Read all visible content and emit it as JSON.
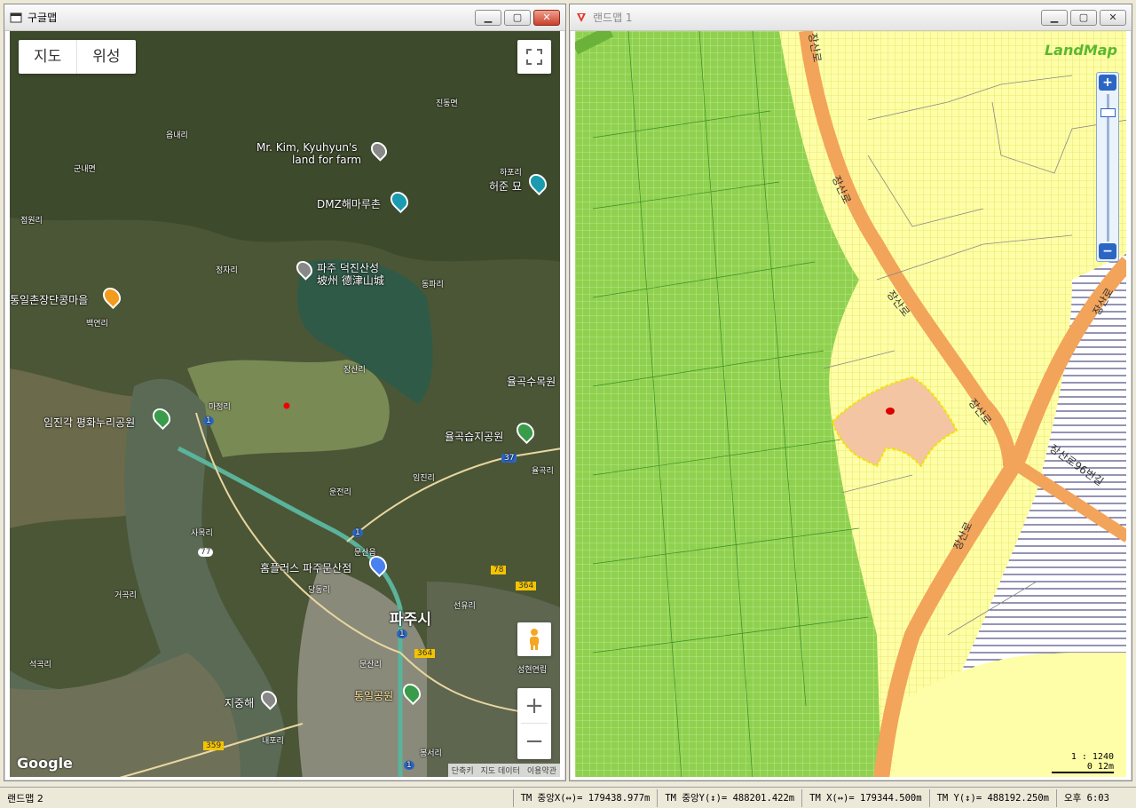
{
  "google_window": {
    "title": "구글맵",
    "map_type": [
      "지도",
      "위성"
    ],
    "footer": [
      "단축키",
      "지도 데이터",
      "이용약관"
    ],
    "logo": "Google",
    "zoom_in": "+",
    "zoom_out": "−",
    "labels": {
      "jindong": "진동면",
      "eupnae": "읍내리",
      "gunnae": "군내면",
      "jeongwon": "점원리",
      "mrkim": "Mr. Kim, Kyuhyun's",
      "mrkim2": "land for farm",
      "hapo": "하포리",
      "heojun": "허준 묘",
      "dmz": "DMZ해마루촌",
      "jeongja": "정자리",
      "deokjin": "파주 덕진산성",
      "deokjin2": "坡州 德津山城",
      "dongpa": "동파리",
      "tongil": "통일촌장단콩마을",
      "baekyeon": "백연리",
      "jangsan": "장산리",
      "yulgok": "율곡수목원",
      "majeong": "마정리",
      "imjingak": "임진각 평화누리공원",
      "yulgokwet": "율곡습지공원",
      "jinseo": "임진리",
      "yulgokri": "율곡리",
      "unjeon": "운전리",
      "samok": "사목리",
      "munsan": "문산읍",
      "homeplus": "홈플러스 파주문산점",
      "dangdong": "당동리",
      "paju": "파주시",
      "geogok": "거곡리",
      "seonyu": "선유리",
      "seokgok": "석곡리",
      "munsanri": "문산리",
      "tongilpark": "통일공원",
      "seonghyeon": "성현연립",
      "jijunghae": "지중해",
      "naepo": "내포리",
      "bongseo": "봉서리",
      "r1": "1",
      "r1b": "1",
      "r1c": "1",
      "r1d": "1",
      "r37": "37",
      "r77": "77",
      "r78": "78",
      "r364": "364",
      "r364b": "364",
      "r359": "359"
    }
  },
  "land_window": {
    "title": "랜드맵 1",
    "logo": "LandMap",
    "zoom_in": "+",
    "zoom_out": "−",
    "scale_ratio": "1 : 1240",
    "scale_bar": "0    12m",
    "roads": [
      "장산로",
      "장산로",
      "장산로",
      "장산로",
      "장산로96번길",
      "장산로",
      "장산로"
    ]
  },
  "statusbar": {
    "left": "랜드맵 2",
    "tm_center_x": "TM 중앙X(↔)= 179438.977m",
    "tm_center_y": "TM 중앙Y(↕)= 488201.422m",
    "tm_x": "TM X(↔)= 179344.500m",
    "tm_y": "TM Y(↕)= 488192.250m",
    "clock": "오후 6:03"
  },
  "colors": {
    "accent": "#2b66c4",
    "green_field": "#8fd14f",
    "parcel": "#f3c5a2",
    "road": "#f2a45a"
  }
}
